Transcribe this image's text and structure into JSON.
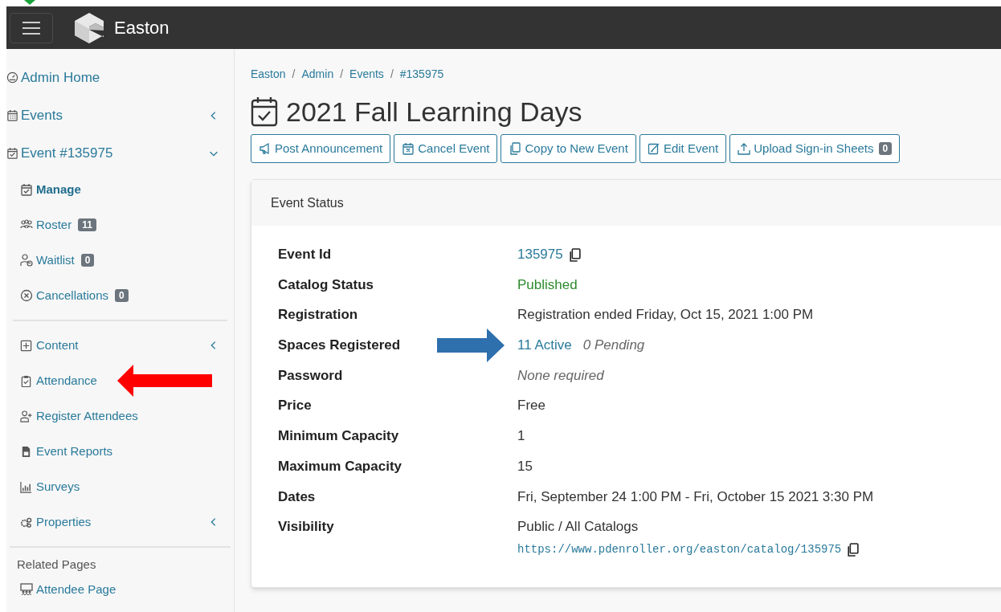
{
  "header": {
    "brand": "Easton"
  },
  "sidebar": {
    "top_items": [
      {
        "label": "Admin Home"
      },
      {
        "label": "Events",
        "expanded": false
      },
      {
        "label": "Event #135975",
        "expanded": true
      }
    ],
    "event_items": [
      {
        "label": "Manage",
        "selected": true
      },
      {
        "label": "Roster",
        "badge": "11",
        "selected": false
      },
      {
        "label": "Waitlist",
        "badge": "0",
        "selected": false
      },
      {
        "label": "Cancellations",
        "badge": "0",
        "selected": false
      }
    ],
    "tool_items": [
      {
        "label": "Content",
        "expanded": false
      },
      {
        "label": "Attendance",
        "pointer": true
      },
      {
        "label": "Register Attendees"
      },
      {
        "label": "Event Reports"
      },
      {
        "label": "Surveys"
      },
      {
        "label": "Properties",
        "expanded": false
      }
    ],
    "related_heading": "Related Pages",
    "related_items": [
      {
        "label": "Attendee Page"
      }
    ]
  },
  "breadcrumb": [
    {
      "kind": "link",
      "text": "Easton"
    },
    {
      "kind": "separator",
      "text": "/"
    },
    {
      "kind": "link",
      "text": "Admin"
    },
    {
      "kind": "separator",
      "text": "/"
    },
    {
      "kind": "link",
      "text": "Events"
    },
    {
      "kind": "separator",
      "text": "/"
    },
    {
      "kind": "link",
      "text": "#135975"
    }
  ],
  "title": "2021 Fall Learning Days",
  "actions": [
    {
      "label": "Post Announcement"
    },
    {
      "label": "Cancel Event"
    },
    {
      "label": "Copy to New Event"
    },
    {
      "label": "Edit Event"
    },
    {
      "label": "Upload Sign-in Sheets",
      "badge": "0"
    }
  ],
  "card": {
    "title": "Event Status",
    "fields": [
      {
        "label": "Event Id",
        "kind": "link",
        "value": "135975",
        "copy": true
      },
      {
        "label": "Catalog Status",
        "kind": "success",
        "value": "Published"
      },
      {
        "label": "Registration",
        "kind": "text",
        "value": "Registration ended Friday, Oct 15, 2021 1:00 PM"
      },
      {
        "label": "Spaces Registered",
        "kind": "spaces",
        "value": "11 Active",
        "secondary": "0 Pending",
        "pointer": true
      },
      {
        "label": "Password",
        "kind": "italic",
        "value": "None required"
      },
      {
        "label": "Price",
        "kind": "text",
        "value": "Free"
      },
      {
        "label": "Minimum Capacity",
        "kind": "text",
        "value": "1"
      },
      {
        "label": "Maximum Capacity",
        "kind": "text",
        "value": "15"
      },
      {
        "label": "Dates",
        "kind": "text",
        "value": "Fri, September 24 1:00 PM - Fri, October 15 2021 3:30 PM"
      },
      {
        "label": "Visibility",
        "kind": "visibility",
        "value": "Public / All Catalogs",
        "url": "https://www.pdenroller.org/easton/catalog/135975"
      }
    ]
  }
}
